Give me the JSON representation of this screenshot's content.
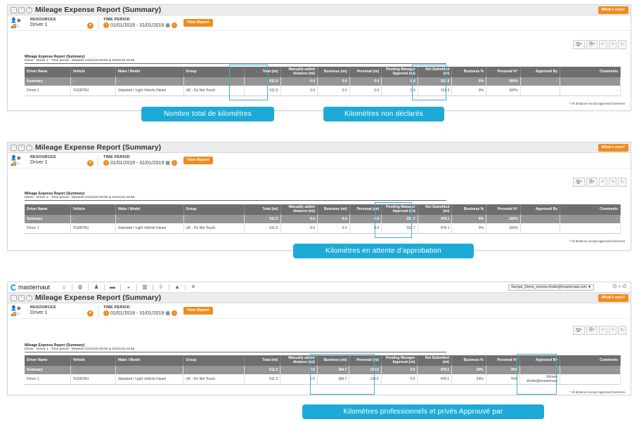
{
  "app": {
    "brand": "masternaut",
    "account": "Europe_Demo_victoria.chokis@masternaut.com ▼"
  },
  "panel_title": "Mileage Expense Report (Summary)",
  "whats_new": "What's new?",
  "resources": {
    "label": "RESOURCES",
    "value": "Driver 1"
  },
  "time_period": {
    "label": "TIME PERIOD",
    "value": "01/01/2019 - 31/01/2019"
  },
  "view_report": "View Report",
  "report": {
    "title": "Mileage Expense Report (Summary)",
    "subtitle": "Driver : Driver 1 - Time period : between 01/01/19 00:00 & 31/01/19 23:59"
  },
  "columns": [
    "Driver Name",
    "Vehicle",
    "Make / Model",
    "Group",
    "Total (mi)",
    "Manually added distance (mi)",
    "Business (mi)",
    "Personal (mi)",
    "Pending Manager Approval (mi)",
    "Not Submitted (mi)",
    "Business %",
    "Personal %*",
    "Approved By",
    "Comments"
  ],
  "footnote": "* All distance except approved business",
  "panels": [
    {
      "summary": [
        "Summary",
        "-",
        "-",
        "-",
        "511.5",
        "0.0",
        "0.0",
        "0.0",
        "0.0",
        "511.5",
        "0%",
        "100%",
        "-",
        "-"
      ],
      "row": [
        "Driver 1",
        "YG067RU",
        "Standard / Light Vehicle Diesel",
        "UK - Do Not Touch",
        "511.5",
        "0.0",
        "0.0",
        "0.0",
        "0.0",
        "511.5",
        "0%",
        "100%",
        "",
        "-"
      ],
      "captions": [
        "Nombre total de kilomètres",
        "Kilomètres non déclarés"
      ]
    },
    {
      "summary": [
        "Summary",
        "-",
        "-",
        "-",
        "511.5",
        "0.0",
        "0.0",
        "0.0",
        "333.7",
        "478.1",
        "0%",
        "100%",
        "-",
        "-"
      ],
      "row": [
        "Driver 1",
        "YG067RU",
        "Standard / Light Vehicle Diesel",
        "UK - Do Not Touch",
        "511.5",
        "0.0",
        "0.0",
        "0.0",
        "333.7",
        "478.1",
        "0%",
        "100%",
        "",
        "-"
      ],
      "captions": [
        "Kilomètres en attente d’approbation"
      ]
    },
    {
      "summary": [
        "Summary",
        "-",
        "-",
        "-",
        "511.5",
        "0.0",
        "184.7",
        "139.5",
        "0.0",
        "478.1",
        "24%",
        "76%",
        "-",
        "-"
      ],
      "row": [
        "Driver 1",
        "YG067RU",
        "Standard / Light Vehicle Diesel",
        "UK - Do Not Touch",
        "511.5",
        "0.0",
        "184.7",
        "139.5",
        "0.0",
        "478.1",
        "24%",
        "76%",
        "Victoria chokis@masternaut",
        "-"
      ],
      "captions": [
        "Kilomètres professionnels et privés Approuvé par"
      ]
    }
  ]
}
